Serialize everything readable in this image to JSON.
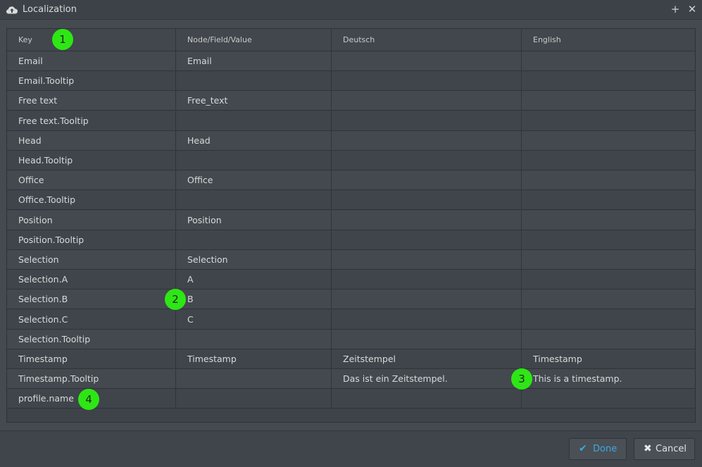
{
  "window": {
    "title": "Localization",
    "icon": "cloud-upload-icon",
    "plus_glyph": "+",
    "close_glyph": "✕"
  },
  "table": {
    "columns": [
      "Key",
      "Node/Field/Value",
      "Deutsch",
      "English"
    ],
    "rows": [
      [
        "Email",
        "Email",
        "",
        ""
      ],
      [
        "Email.Tooltip",
        "",
        "",
        ""
      ],
      [
        "Free text",
        "Free_text",
        "",
        ""
      ],
      [
        "Free text.Tooltip",
        "",
        "",
        ""
      ],
      [
        "Head",
        "Head",
        "",
        ""
      ],
      [
        "Head.Tooltip",
        "",
        "",
        ""
      ],
      [
        "Office",
        "Office",
        "",
        ""
      ],
      [
        "Office.Tooltip",
        "",
        "",
        ""
      ],
      [
        "Position",
        "Position",
        "",
        ""
      ],
      [
        "Position.Tooltip",
        "",
        "",
        ""
      ],
      [
        "Selection",
        "Selection",
        "",
        ""
      ],
      [
        "Selection.A",
        "A",
        "",
        ""
      ],
      [
        "Selection.B",
        "B",
        "",
        ""
      ],
      [
        "Selection.C",
        "C",
        "",
        ""
      ],
      [
        "Selection.Tooltip",
        "",
        "",
        ""
      ],
      [
        "Timestamp",
        "Timestamp",
        "Zeitstempel",
        "Timestamp"
      ],
      [
        "Timestamp.Tooltip",
        "",
        "Das ist ein Zeitstempel.",
        "This is a timestamp."
      ],
      [
        "profile.name",
        "",
        "",
        ""
      ]
    ]
  },
  "markers": [
    "1",
    "2",
    "3",
    "4"
  ],
  "marker_color": "#2ee615",
  "buttons": {
    "done": {
      "label": "Done",
      "icon": "check-icon",
      "glyph": "✔",
      "color": "#3da7e6"
    },
    "cancel": {
      "label": "Cancel",
      "icon": "x-icon",
      "glyph": "✖"
    }
  }
}
